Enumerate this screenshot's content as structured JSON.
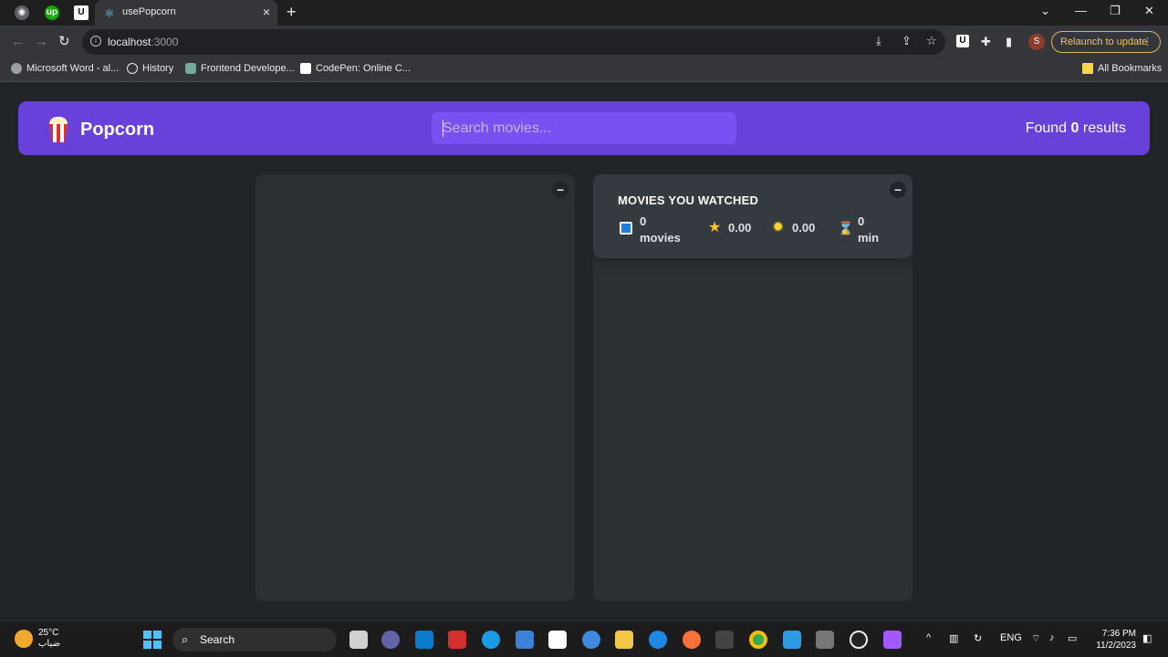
{
  "browser": {
    "tab_title": "usePopcorn",
    "tab2_label": "U",
    "url_host": "localhost",
    "url_port": ":3000",
    "relaunch_label": "Relaunch to update",
    "extension_label": "U",
    "profile_initial": "S",
    "bookmarks": [
      {
        "label": "Microsoft Word - al...",
        "icon": "globe-icon"
      },
      {
        "label": "History",
        "icon": "history-icon"
      },
      {
        "label": "Frontend Develope...",
        "icon": "openai-icon"
      },
      {
        "label": "CodePen: Online C...",
        "icon": "codepen-icon"
      }
    ],
    "all_bookmarks_label": "All Bookmarks"
  },
  "app": {
    "logo_text": "Popcorn",
    "search_placeholder": "Search movies...",
    "results_prefix": "Found",
    "results_count": "0",
    "results_suffix": "results",
    "toggle_symbol": "–",
    "summary": {
      "title": "MOVIES YOU WATCHED",
      "movies_count": "0",
      "movies_unit": "movies",
      "imdb_rating": "0.00",
      "user_rating": "0.00",
      "runtime": "0",
      "runtime_unit": "min"
    }
  },
  "taskbar": {
    "temperature": "25°C",
    "weather_text": "ضباب",
    "search_label": "Search",
    "language": "ENG",
    "time": "7:36 PM",
    "date": "11/2/2023"
  },
  "colors": {
    "primary": "#6741d9",
    "primary_light": "#7950f2",
    "background": "#212529",
    "box": "#2b3035",
    "summary": "#343a40"
  }
}
